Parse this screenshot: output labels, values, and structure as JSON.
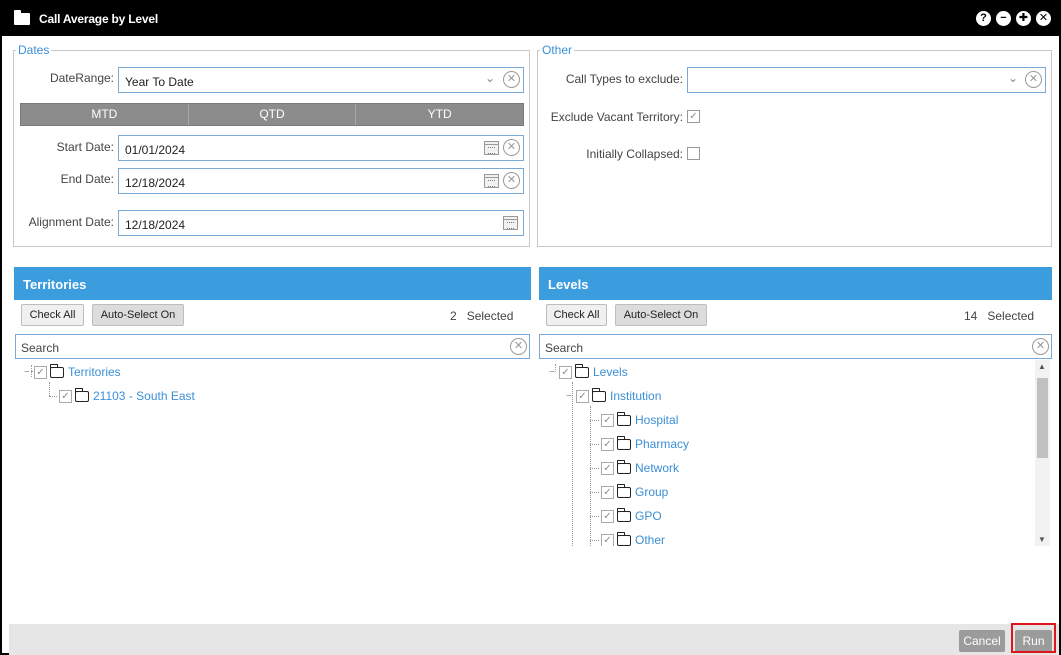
{
  "window": {
    "title": "Call Average by Level",
    "controls": [
      "?",
      "−",
      "✚",
      "✕"
    ]
  },
  "dates": {
    "legend": "Dates",
    "date_range": {
      "label": "DateRange:",
      "value": "Year To Date"
    },
    "segments": [
      "MTD",
      "QTD",
      "YTD"
    ],
    "start_date": {
      "label": "Start Date:",
      "value": "01/01/2024"
    },
    "end_date": {
      "label": "End Date:",
      "value": "12/18/2024"
    },
    "alignment_date": {
      "label": "Alignment Date:",
      "value": "12/18/2024"
    }
  },
  "other": {
    "legend": "Other",
    "call_types": {
      "label": "Call Types to exclude:",
      "value": ""
    },
    "exclude_vacant": {
      "label": "Exclude Vacant Territory:",
      "checked": true
    },
    "initially_collapsed": {
      "label": "Initially Collapsed:",
      "checked": false
    }
  },
  "territories": {
    "title": "Territories",
    "check_all": "Check All",
    "auto_select": "Auto-Select On",
    "selected_count": "2",
    "selected_label": "Selected",
    "search_placeholder": "Search",
    "tree": [
      {
        "label": "Territories",
        "level": 0,
        "checked": true
      },
      {
        "label": "21103 - South East",
        "level": 1,
        "checked": true
      }
    ]
  },
  "levels": {
    "title": "Levels",
    "check_all": "Check All",
    "auto_select": "Auto-Select On",
    "selected_count": "14",
    "selected_label": "Selected",
    "search_placeholder": "Search",
    "tree": [
      {
        "label": "Levels",
        "level": 0,
        "checked": true
      },
      {
        "label": "Institution",
        "level": 1,
        "checked": true
      },
      {
        "label": "Hospital",
        "level": 2,
        "checked": true
      },
      {
        "label": "Pharmacy",
        "level": 2,
        "checked": true
      },
      {
        "label": "Network",
        "level": 2,
        "checked": true
      },
      {
        "label": "Group",
        "level": 2,
        "checked": true
      },
      {
        "label": "GPO",
        "level": 2,
        "checked": true
      },
      {
        "label": "Other",
        "level": 2,
        "checked": true
      }
    ]
  },
  "footer": {
    "cancel": "Cancel",
    "run": "Run"
  },
  "colors": {
    "accent": "#3b9ddd",
    "highlight": "#e0141b",
    "titlebar": "#000000"
  }
}
